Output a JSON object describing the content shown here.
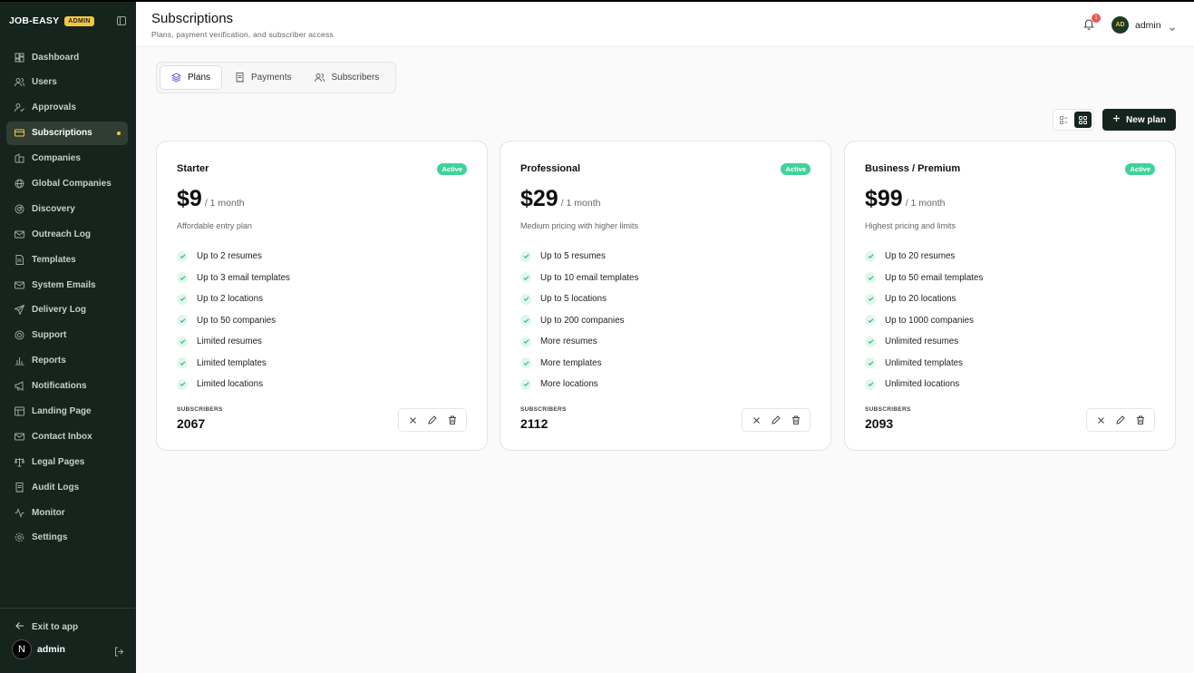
{
  "brand": {
    "name": "JOB-EASY",
    "badge": "ADMIN"
  },
  "sidebar": {
    "items": [
      {
        "label": "Dashboard",
        "icon": "dashboard-icon"
      },
      {
        "label": "Users",
        "icon": "users-icon"
      },
      {
        "label": "Approvals",
        "icon": "approvals-icon"
      },
      {
        "label": "Subscriptions",
        "icon": "credit-card-icon",
        "active": true
      },
      {
        "label": "Companies",
        "icon": "companies-icon"
      },
      {
        "label": "Global Companies",
        "icon": "globe-icon"
      },
      {
        "label": "Discovery",
        "icon": "radar-icon"
      },
      {
        "label": "Outreach Log",
        "icon": "mail-icon"
      },
      {
        "label": "Templates",
        "icon": "templates-icon"
      },
      {
        "label": "System Emails",
        "icon": "mail-icon"
      },
      {
        "label": "Delivery Log",
        "icon": "send-icon"
      },
      {
        "label": "Support",
        "icon": "support-icon"
      },
      {
        "label": "Reports",
        "icon": "bar-chart-icon"
      },
      {
        "label": "Notifications",
        "icon": "megaphone-icon"
      },
      {
        "label": "Landing Page",
        "icon": "layout-icon"
      },
      {
        "label": "Contact Inbox",
        "icon": "inbox-icon"
      },
      {
        "label": "Legal Pages",
        "icon": "scale-icon"
      },
      {
        "label": "Audit Logs",
        "icon": "receipt-icon"
      },
      {
        "label": "Monitor",
        "icon": "activity-icon"
      },
      {
        "label": "Settings",
        "icon": "gear-icon"
      }
    ],
    "exit_label": "Exit to app",
    "user": {
      "initial": "N",
      "name": "admin"
    }
  },
  "header": {
    "title": "Subscriptions",
    "subtitle": "Plans, payment verification, and subscriber access",
    "notifications": "1",
    "avatar_initials": "AD",
    "username": "admin"
  },
  "tabs": [
    {
      "label": "Plans",
      "icon": "layers-icon",
      "active": true
    },
    {
      "label": "Payments",
      "icon": "receipt-icon"
    },
    {
      "label": "Subscribers",
      "icon": "users-icon"
    }
  ],
  "toolbar": {
    "new_plan_label": "New plan"
  },
  "plans": [
    {
      "name": "Starter",
      "status": "Active",
      "price": "$9",
      "period": "/ 1 month",
      "description": "Affordable entry plan",
      "features": [
        "Up to 2 resumes",
        "Up to 3 email templates",
        "Up to 2 locations",
        "Up to 50 companies",
        "Limited resumes",
        "Limited templates",
        "Limited locations"
      ],
      "subscribers_label": "SUBSCRIBERS",
      "subscribers": "2067"
    },
    {
      "name": "Professional",
      "status": "Active",
      "price": "$29",
      "period": "/ 1 month",
      "description": "Medium pricing with higher limits",
      "features": [
        "Up to 5 resumes",
        "Up to 10 email templates",
        "Up to 5 locations",
        "Up to 200 companies",
        "More resumes",
        "More templates",
        "More locations"
      ],
      "subscribers_label": "SUBSCRIBERS",
      "subscribers": "2112"
    },
    {
      "name": "Business / Premium",
      "status": "Active",
      "price": "$99",
      "period": "/ 1 month",
      "description": "Highest pricing and limits",
      "features": [
        "Up to 20 resumes",
        "Up to 50 email templates",
        "Up to 20 locations",
        "Up to 1000 companies",
        "Unlimited resumes",
        "Unlimited templates",
        "Unlimited locations"
      ],
      "subscribers_label": "SUBSCRIBERS",
      "subscribers": "2093"
    }
  ],
  "colors": {
    "sidebar_bg": "#16241e",
    "accent": "#f5c542",
    "active_badge": "#3ed39a"
  }
}
